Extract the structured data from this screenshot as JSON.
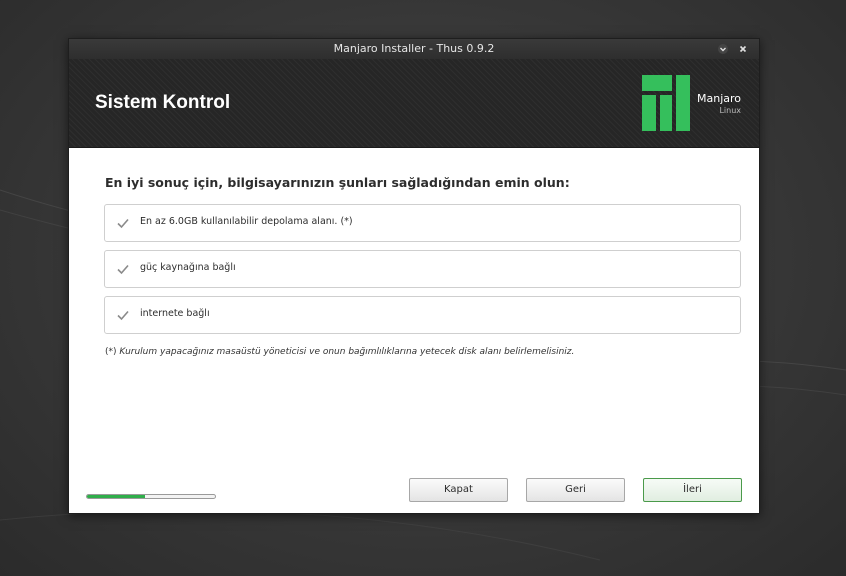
{
  "window": {
    "title": "Manjaro Installer - Thus 0.9.2",
    "controls": {
      "minimize_glyph": "⌄",
      "close_glyph": "×"
    }
  },
  "header": {
    "title": "Sistem Kontrol",
    "logo": {
      "name": "Manjaro",
      "sub": "Linux",
      "color": "#35bf5c"
    }
  },
  "content": {
    "heading": "En iyi sonuç için, bilgisayarınızın şunları sağladığından emin olun:",
    "requirements": [
      {
        "label": "En az 6.0GB kullanılabilir depolama alanı. (*)",
        "status": "ok",
        "icon": "check-icon"
      },
      {
        "label": "güç kaynağına bağlı",
        "status": "ok",
        "icon": "check-icon"
      },
      {
        "label": "internete bağlı",
        "status": "ok",
        "icon": "check-icon"
      }
    ],
    "footnote_prefix": "(*)",
    "footnote": "Kurulum yapacağınız masaüstü yöneticisi ve onun bağımlılıklarına yetecek disk alanı belirlemelisiniz."
  },
  "progress": {
    "value": 0.45,
    "color": "#2fae4a"
  },
  "buttons": {
    "quit": "Kapat",
    "back": "Geri",
    "next": "İleri"
  },
  "colors": {
    "accent": "#35bf5c",
    "header_bg": "#262626",
    "titlebar_bg": "#333333"
  }
}
